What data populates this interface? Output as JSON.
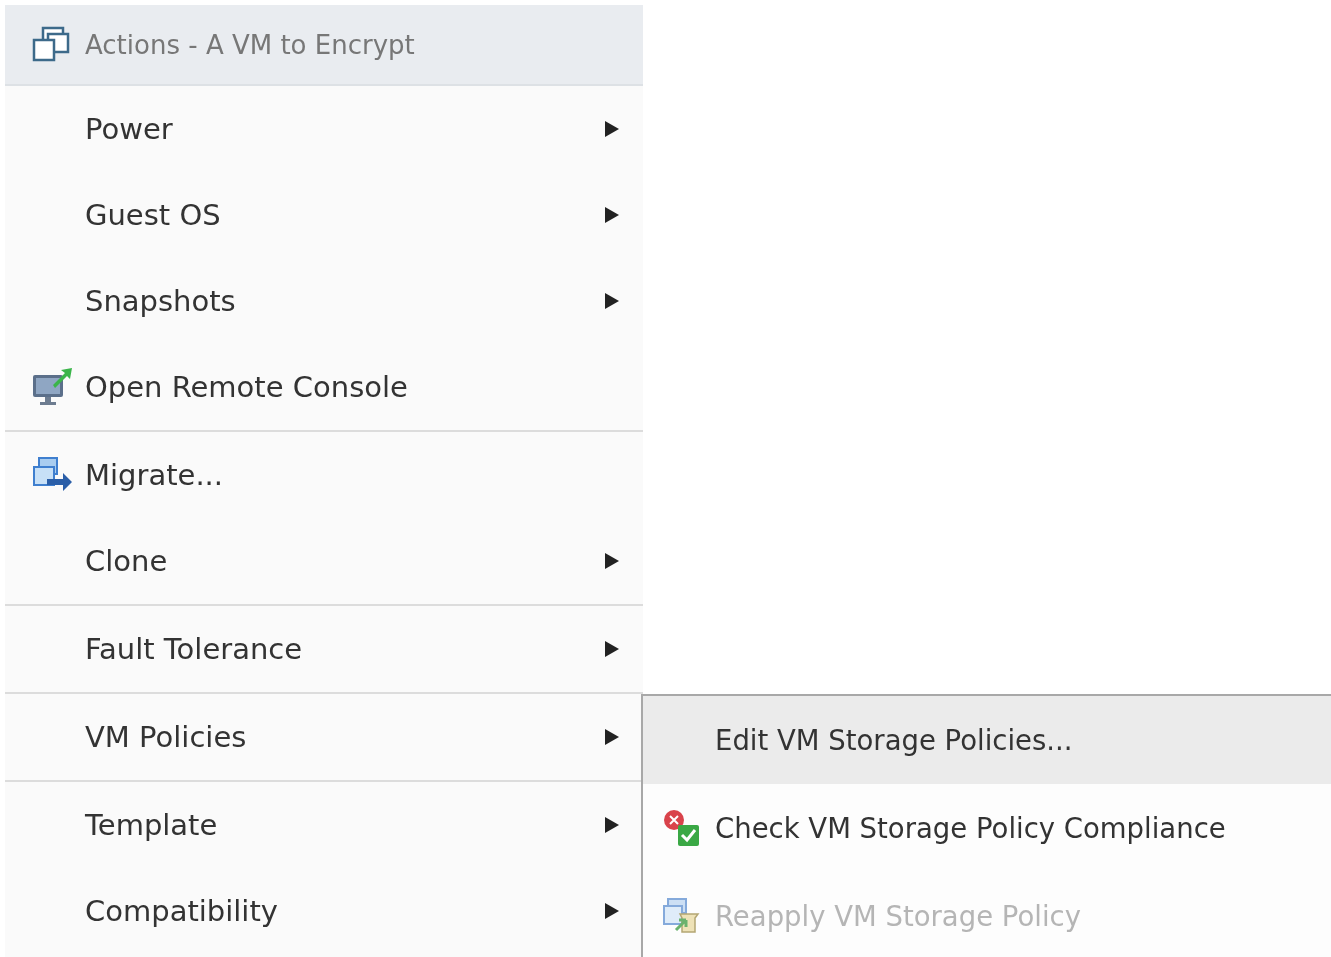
{
  "menu": {
    "title": "Actions - A VM to Encrypt",
    "items": [
      {
        "label": "Power",
        "kind": "submenu",
        "divider_after": false
      },
      {
        "label": "Guest OS",
        "kind": "submenu",
        "divider_after": false
      },
      {
        "label": "Snapshots",
        "kind": "submenu",
        "divider_after": false
      },
      {
        "label": "Open Remote Console",
        "kind": "console",
        "divider_after": true
      },
      {
        "label": "Migrate...",
        "kind": "migrate",
        "divider_after": false
      },
      {
        "label": "Clone",
        "kind": "submenu",
        "divider_after": true
      },
      {
        "label": "Fault Tolerance",
        "kind": "submenu",
        "divider_after": true
      },
      {
        "label": "VM Policies",
        "kind": "submenu",
        "divider_after": true
      },
      {
        "label": "Template",
        "kind": "submenu",
        "divider_after": false
      },
      {
        "label": "Compatibility",
        "kind": "submenu",
        "divider_after": false
      }
    ]
  },
  "submenu": {
    "items": [
      {
        "label": "Edit VM Storage Policies...",
        "kind": "plain",
        "selected": true,
        "disabled": false
      },
      {
        "label": "Check VM Storage Policy Compliance",
        "kind": "compliance",
        "selected": false,
        "disabled": false
      },
      {
        "label": "Reapply VM Storage Policy",
        "kind": "reapply",
        "selected": false,
        "disabled": true
      }
    ]
  }
}
